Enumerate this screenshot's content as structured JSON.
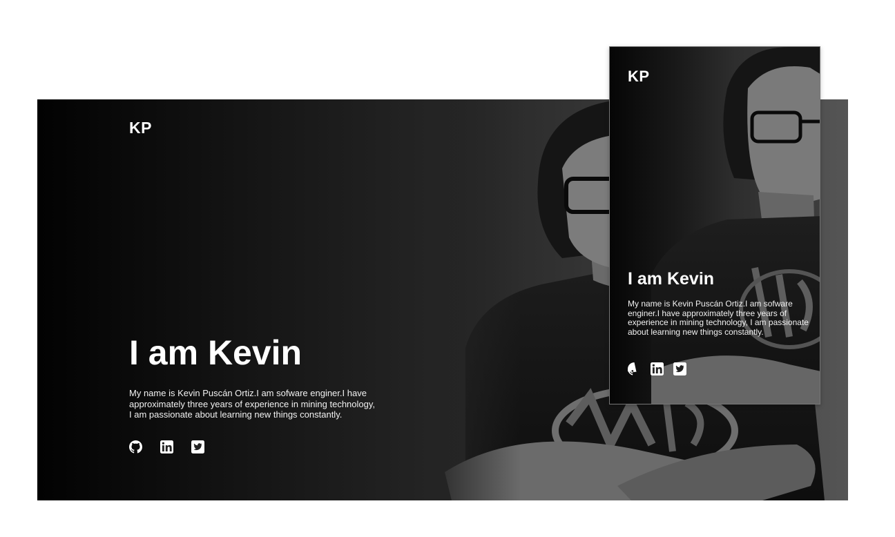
{
  "desktop": {
    "logo": "KP",
    "title": "I am Kevin",
    "description": "My name is Kevin Puscán Ortiz.I am sofware enginer.I have approximately three years of experience in mining technology, I am passionate about learning new things constantly.",
    "socials": [
      {
        "icon": "github-icon"
      },
      {
        "icon": "linkedin-icon"
      },
      {
        "icon": "twitter-icon"
      }
    ]
  },
  "mobile": {
    "logo": "KP",
    "title": "I am Kevin",
    "description": "My name is Kevin Puscán Ortiz.I am sofware enginer.I have approximately three years of experience in mining technology, I am passionate about learning new things constantly.",
    "socials": [
      {
        "icon": "github-icon"
      },
      {
        "icon": "linkedin-icon"
      },
      {
        "icon": "twitter-icon"
      }
    ]
  },
  "colors": {
    "page_background": "#ffffff",
    "hero_dark": "#020202",
    "text": "#ffffff"
  }
}
